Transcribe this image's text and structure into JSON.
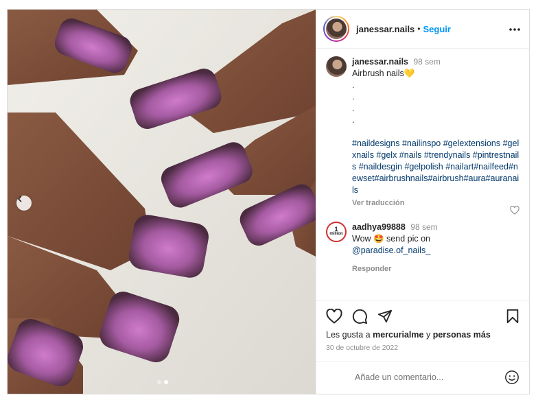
{
  "post": {
    "username": "janessar.nails",
    "separator": "•",
    "follow_label": "Seguir",
    "more_label": "•••"
  },
  "caption": {
    "username": "janessar.nails",
    "time": "98 sem",
    "text": "Airbrush nails💛",
    "dot_lines": [
      ".",
      ".",
      ".",
      "."
    ],
    "hashtags": "#naildesigns #nailinspo #gelextensions #gelxnails #gelx #nails #trendynails #pintrestnails #naildesgin #gelpolish #nailart#nailfeed#newset#airbrushnails#airbrush#aura#auranails",
    "translate_label": "Ver traducción"
  },
  "comment": {
    "avatar_text_top": "1",
    "avatar_text_bottom": "million",
    "username": "aadhya99888",
    "time": "98 sem",
    "text_line1": "Wow 🤩 send pic on",
    "mention": "@paradise.of_nails_",
    "reply_label": "Responder"
  },
  "likes": {
    "prefix": "Les gusta a",
    "user": "mercurialme",
    "connector": "y",
    "others": "personas más"
  },
  "date": "30 de octubre de 2022",
  "add_comment": {
    "placeholder": "Añade un comentario..."
  },
  "carousel": {
    "total_slides": 2,
    "active_slide": 2
  },
  "icons": {
    "prev": "chevron-left-icon",
    "like": "heart-icon",
    "comment": "comment-icon",
    "share": "paper-plane-icon",
    "save": "bookmark-icon",
    "emoji": "smiley-icon",
    "comment_like": "heart-small-icon"
  },
  "colors": {
    "accent": "#0095f6",
    "link": "#00376b",
    "muted": "#8e8e8e",
    "nail_pink": "#c06ab9",
    "nail_dark": "#4a2a3f"
  }
}
